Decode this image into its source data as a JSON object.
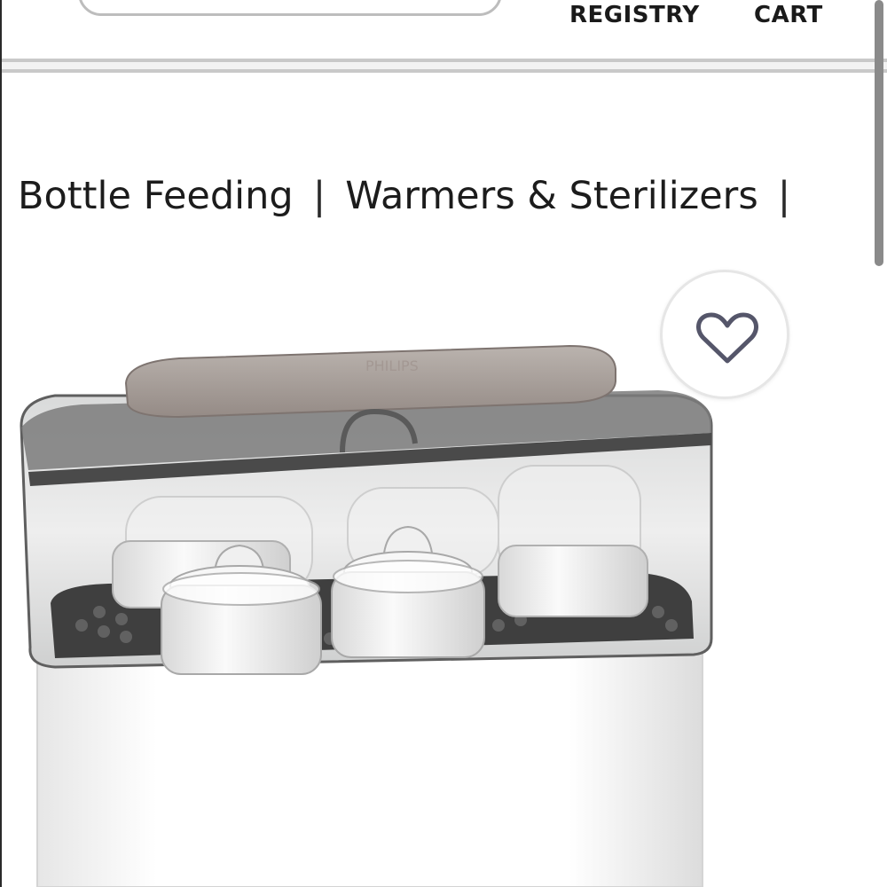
{
  "header": {
    "nav": {
      "registry": "REGISTRY",
      "cart": "CART"
    }
  },
  "breadcrumb": {
    "items": [
      "Bottle Feeding",
      "Warmers & Sterilizers"
    ],
    "separator": "|"
  },
  "favorite": {
    "icon": "heart-icon"
  },
  "product": {
    "image": "bottle-sterilizer-image"
  },
  "colors": {
    "text": "#1f1f1f",
    "border": "#c9c9c9",
    "lid": "#a59c98"
  }
}
